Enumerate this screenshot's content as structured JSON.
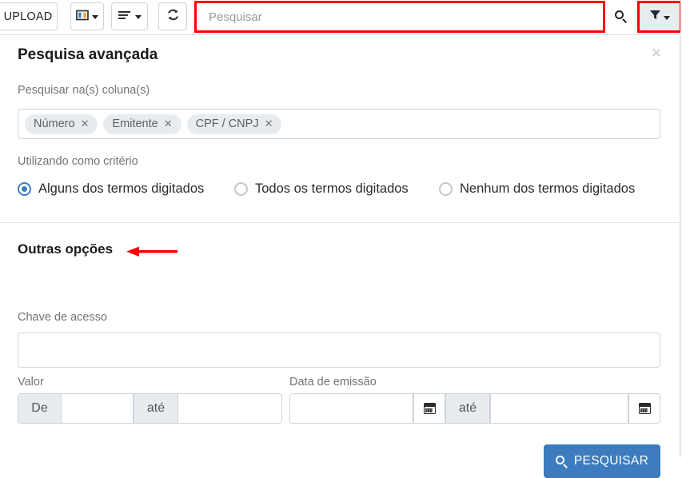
{
  "toolbar": {
    "upload_label": "UPLOAD",
    "columns_icon": "columns-icon",
    "list_icon": "list-lines-icon",
    "refresh_icon": "refresh-icon",
    "search_placeholder": "Pesquisar",
    "search_value": "",
    "search_icon": "search-icon",
    "filter_icon": "filter-funnel-icon",
    "highlight_color": "#ff0000"
  },
  "panel": {
    "title": "Pesquisa avançada",
    "close_label": "×",
    "close_icon": "close-icon",
    "columns_field_label": "Pesquisar na(s) coluna(s)",
    "chips": [
      {
        "label": "Número",
        "remove": "✕"
      },
      {
        "label": "Emitente",
        "remove": "✕"
      },
      {
        "label": "CPF / CNPJ",
        "remove": "✕"
      }
    ],
    "criteria_label": "Utilizando como critério",
    "criteria_options": [
      {
        "label": "Alguns dos termos digitados",
        "selected": true
      },
      {
        "label": "Todos os termos digitados",
        "selected": false
      },
      {
        "label": "Nenhum dos termos digitados",
        "selected": false
      }
    ],
    "other_options_title": "Outras opções",
    "annotation_arrow": "left-pointing-red-arrow",
    "chave_label": "Chave de acesso",
    "chave_value": "",
    "valor_label": "Valor",
    "valor_from_addon": "De",
    "valor_from_value": "",
    "valor_until_addon": "até",
    "valor_until_value": "",
    "data_label": "Data de emissão",
    "data_from_value": "",
    "data_until_addon": "até",
    "data_until_value": "",
    "calendar_icon": "calendar-icon",
    "submit_label": "PESQUISAR",
    "submit_icon": "search-icon",
    "accent_color": "#3c7cbf",
    "radio_color": "#3d7ebd"
  }
}
